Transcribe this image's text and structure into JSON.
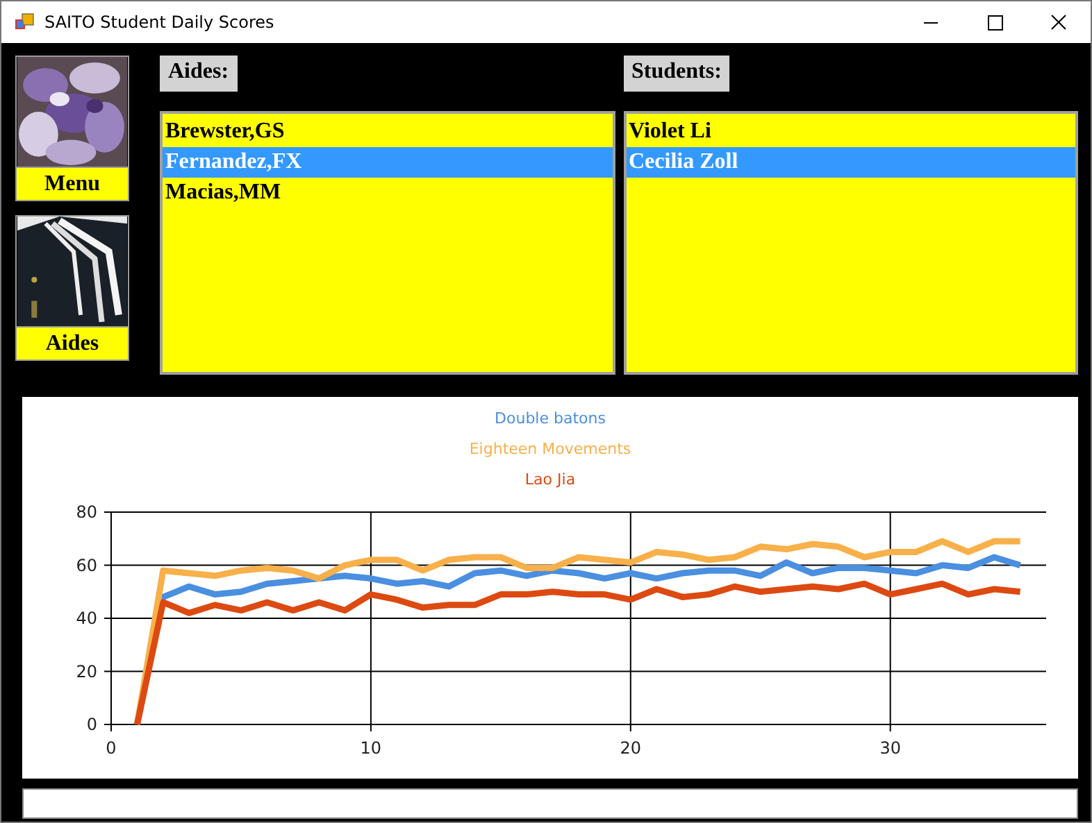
{
  "window": {
    "title": "SAITO Student Daily Scores"
  },
  "nav": [
    {
      "label": "Menu",
      "kind": "flowers"
    },
    {
      "label": "Aides",
      "kind": "uniform"
    }
  ],
  "aides": {
    "label": "Aides:",
    "items": [
      {
        "name": "Brewster,GS",
        "selected": false
      },
      {
        "name": "Fernandez,FX",
        "selected": true
      },
      {
        "name": "Macias,MM",
        "selected": false
      }
    ]
  },
  "students": {
    "label": "Students:",
    "items": [
      {
        "name": "Violet Li",
        "selected": false
      },
      {
        "name": "Cecilia Zoll",
        "selected": true
      }
    ]
  },
  "chart": {
    "chart_data": {
      "type": "line",
      "grid": true,
      "x": [
        1,
        2,
        3,
        4,
        5,
        6,
        7,
        8,
        9,
        10,
        11,
        12,
        13,
        14,
        15,
        16,
        17,
        18,
        19,
        20,
        21,
        22,
        23,
        24,
        25,
        26,
        27,
        28,
        29,
        30,
        31,
        32,
        33,
        34,
        35
      ],
      "xlim": [
        0,
        36
      ],
      "ylim": [
        0,
        80
      ],
      "xticks": [
        0,
        10,
        20,
        30
      ],
      "yticks": [
        0,
        20,
        40,
        60,
        80
      ],
      "series": [
        {
          "name": "Double batons",
          "color": "#4a8fe0",
          "values": [
            0,
            48,
            52,
            49,
            50,
            53,
            54,
            55,
            56,
            55,
            53,
            54,
            52,
            57,
            58,
            56,
            58,
            57,
            55,
            57,
            55,
            57,
            58,
            58,
            56,
            61,
            57,
            59,
            59,
            58,
            57,
            60,
            59,
            63,
            60
          ]
        },
        {
          "name": "Eighteen Movements",
          "color": "#f8b04a",
          "values": [
            0,
            58,
            57,
            56,
            58,
            59,
            58,
            55,
            60,
            62,
            62,
            58,
            62,
            63,
            63,
            59,
            59,
            63,
            62,
            61,
            65,
            64,
            62,
            63,
            67,
            66,
            68,
            67,
            63,
            65,
            65,
            69,
            65,
            69,
            69
          ]
        },
        {
          "name": "Lao Jia",
          "color": "#dc4a12",
          "values": [
            0,
            46,
            42,
            45,
            43,
            46,
            43,
            46,
            43,
            49,
            47,
            44,
            45,
            45,
            49,
            49,
            50,
            49,
            49,
            47,
            51,
            48,
            49,
            52,
            50,
            51,
            52,
            51,
            53,
            49,
            51,
            53,
            49,
            51,
            50
          ]
        }
      ]
    }
  }
}
